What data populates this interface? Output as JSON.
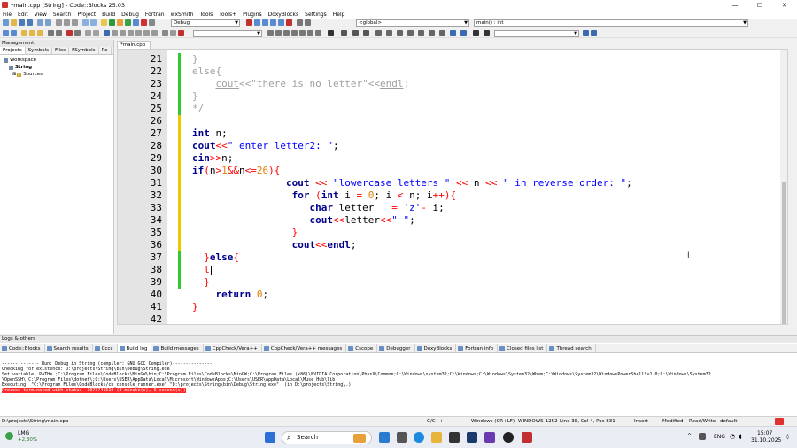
{
  "window": {
    "title": "*main.cpp [String] - Code::Blocks 25.03",
    "min": "—",
    "max": "☐",
    "close": "✕"
  },
  "menu": [
    "File",
    "Edit",
    "View",
    "Search",
    "Project",
    "Build",
    "Debug",
    "Fortran",
    "wxSmith",
    "Tools",
    "Tools+",
    "Plugins",
    "DoxyBlocks",
    "Settings",
    "Help"
  ],
  "toolbar": {
    "build_target": "Debug",
    "scope": "<global>",
    "function": "main() : int"
  },
  "management": {
    "header": "Management",
    "tabs": [
      "Projects",
      "Symbols",
      "Files",
      "FSymbols",
      "Re"
    ],
    "tree": [
      "Workspace",
      "String",
      "Sources"
    ]
  },
  "editor": {
    "tab": "*main.cpp",
    "lines": [
      {
        "n": "21",
        "html": "<span class=\"cm\">}</span>"
      },
      {
        "n": "22",
        "html": "<span class=\"cm\">else{</span>"
      },
      {
        "n": "23",
        "html": "<span class=\"cm\">    <span class=\"ul\">cout</span>&lt;&lt;\"there is no letter\"&lt;&lt;<span class=\"ul\">endl</span>;</span>"
      },
      {
        "n": "24",
        "html": "<span class=\"cm\">}</span>"
      },
      {
        "n": "25",
        "html": "<span class=\"cm\">*/</span>"
      },
      {
        "n": "26",
        "html": ""
      },
      {
        "n": "27",
        "html": "<span class=\"kw\">int</span> n;"
      },
      {
        "n": "28",
        "html": "<span class=\"kw\">cout</span><span class=\"op\">&lt;&lt;</span><span class=\"str\">\" enter letter2: \"</span>;"
      },
      {
        "n": "29",
        "html": "<span class=\"kw\">cin</span><span class=\"op\">&gt;&gt;</span>n;"
      },
      {
        "n": "30",
        "html": "<span class=\"kw\">if</span><span class=\"op\">(</span>n<span class=\"op\">&gt;</span><span class=\"num\">1</span><span class=\"op\">&amp;&amp;</span>n<span class=\"op\">&lt;=</span><span class=\"num\">26</span><span class=\"op\">){</span>"
      },
      {
        "n": "31",
        "html": "                <span class=\"kw\">cout</span> <span class=\"op\">&lt;&lt;</span> <span class=\"str\">\"lowercase letters \"</span> <span class=\"op\">&lt;&lt;</span> n <span class=\"op\">&lt;&lt;</span> <span class=\"str\">\" in reverse order: \"</span>;"
      },
      {
        "n": "32",
        "html": "                 <span class=\"kw\">for</span> <span class=\"op\">(</span><span class=\"kw\">int</span> i <span class=\"op\">=</span> <span class=\"num\">0</span>; i <span class=\"op\">&lt;</span> n; i<span class=\"op\">++){</span>"
      },
      {
        "n": "33",
        "html": "                    <span class=\"kw\">char</span> letter   <span class=\"op\">=</span> <span class=\"str\">'z'</span><span class=\"op\">-</span> i;"
      },
      {
        "n": "34",
        "html": "                    <span class=\"kw\">cout</span><span class=\"op\">&lt;&lt;</span>letter<span class=\"op\">&lt;&lt;</span><span class=\"str\">\" \"</span>;"
      },
      {
        "n": "35",
        "html": "                 <span class=\"op\">}</span>"
      },
      {
        "n": "36",
        "html": "                 <span class=\"kw\">cout</span><span class=\"op\">&lt;&lt;</span><span class=\"kw\">endl</span>;"
      },
      {
        "n": "37",
        "html": "  <span class=\"op\">}</span><span class=\"kw\">else</span><span class=\"op\">{</span>"
      },
      {
        "n": "38",
        "html": "  <span class=\"op\">l</span>"
      },
      {
        "n": "39",
        "html": "  <span class=\"op\">}</span>"
      },
      {
        "n": "40",
        "html": "    <span class=\"kw\">return</span> <span class=\"num\">0</span>;"
      },
      {
        "n": "41",
        "html": "<span class=\"op\">}</span>"
      },
      {
        "n": "42",
        "html": ""
      }
    ]
  },
  "logs": {
    "header": "Logs & others",
    "tabs": [
      "Code::Blocks",
      "Search results",
      "Cccc",
      "Build log",
      "Build messages",
      "CppCheck/Vera++",
      "CppCheck/Vera++ messages",
      "Cscope",
      "Debugger",
      "DoxyBlocks",
      "Fortran info",
      "Closed files list",
      "Thread search"
    ],
    "lines": [
      "-------------- Run: Debug in String (compiler: GNU GCC Compiler)---------------",
      "",
      "Checking for existence: D:\\projects\\String\\bin\\Debug\\String.exe",
      "Set variable: PATH=.;C:\\Program Files\\CodeBlocks\\MinGW\\bin;C:\\Program Files\\CodeBlocks\\MinGW;C:\\Program Files (x86)\\NVIDIA Corporation\\PhysX\\Common;C:\\Windows\\system32;C:\\Windows;C:\\Windows\\System32\\Wbem;C:\\Windows\\System32\\WindowsPowerShell\\v1.0;C:\\Windows\\System32",
      "\\OpenSSH\\;C:\\Program Files\\dotnet\\;C:\\Users\\USER\\AppData\\Local\\Microsoft\\WindowsApps;C:\\Users\\USER\\AppData\\Local\\Muse Hub\\lib",
      "Executing: \"C:\\Program Files\\CodeBlocks/cb_console_runner.exe\" \"D:\\projects\\String\\bin\\Debug\\String.exe\"  (in D:\\projects\\String\\.)"
    ],
    "error": "Process terminated with status -1073741510 (0 minute(s), 6 second(s))"
  },
  "status": {
    "path": "D:\\projects\\String\\main.cpp",
    "lang": "C/C++",
    "eol": "Windows (CR+LF)",
    "encoding": "WINDOWS-1252",
    "pos": "Line 38, Col 4, Pos 831",
    "insert": "Insert",
    "modified": "Modified",
    "rw": "Read/Write",
    "default": "default"
  },
  "taskbar": {
    "weather_temp": "LMG",
    "weather_change": "+2,30%",
    "search": "Search",
    "lang": "ENG",
    "time": "15:07",
    "date": "31.10.2025"
  }
}
